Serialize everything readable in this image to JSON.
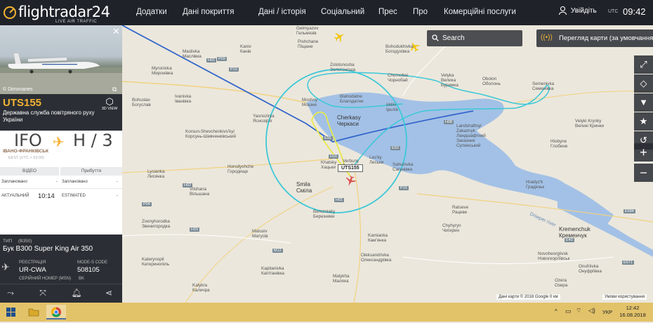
{
  "topbar": {
    "brand": "flightradar24",
    "tagline": "LIVE AIR TRAFFIC",
    "nav": [
      "Додатки",
      "Дані покриття",
      "Дані / історія",
      "Соціальний",
      "Прес",
      "Про",
      "Комерційні послуги"
    ],
    "login": "Увійдіть",
    "utc_label": "UTC",
    "clock": "09:42"
  },
  "map": {
    "search_placeholder": "Search",
    "view_label": "Перегляд карти (за умовчанням)",
    "flight_label": "UTS155",
    "attribution": "Дані карти © 2018 Google   0 км",
    "terms": "Умови користування",
    "places_small": [
      {
        "t": "Gelmyazov\nГельмязів"
      },
      {
        "t": "Pishchane\nПіщане"
      },
      {
        "t": "Bohodukhivka\nБогодухівка"
      },
      {
        "t": "Zolotonosha\nЗолотоноша"
      },
      {
        "t": "Chornobai\nЧорнобай"
      },
      {
        "t": "Myronivka\nМиронівка"
      },
      {
        "t": "Maslivka\nМаслівка"
      },
      {
        "t": "Kaniv\nКанів"
      },
      {
        "t": "Bohuslav\nБогуслав"
      },
      {
        "t": "Ivanivka\nІванівка"
      },
      {
        "t": "Moshny\nМошни"
      },
      {
        "t": "Blahodatne\nБлагодатне"
      },
      {
        "t": "Velyka\nВелика\nБуримка"
      },
      {
        "t": "Irkliiv\nІрклїв"
      },
      {
        "t": "Obolon\nОболонь"
      },
      {
        "t": "Semenivka\nСеменівка"
      },
      {
        "t": "Yasnozirya\nЯснозір'я"
      },
      {
        "t": "Korsun-Shevchenkivs'kyi\nКорсунь-Шевченківський"
      },
      {
        "t": "Landshaftnyi\nZakaznyk\nЛандшафтний\nЗаказник\nСулинський"
      },
      {
        "t": "Velyki Krynky\nВеликі Кринки"
      },
      {
        "t": "Hlobyne\nГлобине"
      },
      {
        "t": "Lysianka\nЛисянка"
      },
      {
        "t": "Horodyshche\nГородище"
      },
      {
        "t": "Khatsky\nХацьки"
      },
      {
        "t": "Verbuny\nВербуни"
      },
      {
        "t": "Les'ky\nЛеськи"
      },
      {
        "t": "Sahunivka\nСагунівка"
      },
      {
        "t": "Zvenyhorodka\nЗвенигородка"
      },
      {
        "t": "Vilshana\nВільшана"
      },
      {
        "t": "Berezniaky\nБерезняки"
      },
      {
        "t": "Chyhyryn\nЧигирин"
      },
      {
        "t": "Hradyz'k\nГрадизьк"
      },
      {
        "t": "Ratseve\nРацеве"
      },
      {
        "t": "Kamianka\nКам'янка"
      },
      {
        "t": "Matusiv\nМатусів"
      },
      {
        "t": "Katerynopil\nКатеринопіль"
      },
      {
        "t": "Oleksandrivka\nОлександрівка"
      },
      {
        "t": "Novoheorgiivsk\nНовогеоргіївськ"
      },
      {
        "t": "Kapitanivka\nКапітанівка"
      },
      {
        "t": "Malykha\nМаляха"
      },
      {
        "t": "Onufriivka\nОнуфріївка"
      },
      {
        "t": "Ozera\nОзера"
      },
      {
        "t": "Kalykra\nКаличра"
      }
    ],
    "places_big": [
      {
        "t": "Cherkasy\nЧеркаси"
      },
      {
        "t": "Smila\nСміла"
      },
      {
        "t": "Kremenchuk\nКременчук"
      }
    ],
    "river_label": "Dnieper river",
    "roads": [
      "H01",
      "P09",
      "P10",
      "H16",
      "H08",
      "E50",
      "P04",
      "H15",
      "E95",
      "E584",
      "H02",
      "M12",
      "P15",
      "E571",
      "E40",
      "H01"
    ]
  },
  "sidebar": {
    "photo_credit": "© Dimonanes",
    "callsign": "UTS155",
    "airline": "Державна служба повітряного руху України",
    "view3d": "3D VIEW",
    "origin_iata": "IFO",
    "dest_iata": "H / 3",
    "origin_city": "ІВАНО-ФРАНКІВСЬК",
    "origin_tz": "EEST (UTC + 03:00)",
    "col_departure": "ВІДЕО",
    "col_arrival": "Прибуття",
    "scheduled": "Заплановано",
    "scheduled_val_dep": "-",
    "scheduled_arr": "Заплановано",
    "scheduled_val_arr": "-",
    "actual": "АКТУАЛЬНИЙ",
    "actual_val": "10:14",
    "estimated": "ESTIMATED",
    "estimated_val": "-",
    "type_label": "ТИП",
    "type_code": "(B350)",
    "type_name": "Бук B300 Super King Air 350",
    "reg_label": "РЕЄСТРАЦІЯ",
    "reg_val": "UR-CWA",
    "modes_label": "MODE-S CODE",
    "modes_val": "508105",
    "serial_label": "СЕРІЙНИЙ НОМЕР (MSN)",
    "serial_val": "BK"
  },
  "taskbar": {
    "lang": "УКР",
    "time": "12:42",
    "date": "16.08.2018"
  },
  "colors": {
    "accent": "#f3b233",
    "track_blue": "#3366cc",
    "track_cyan": "#3cc8d8",
    "track_yellow": "#e8e84a",
    "water": "#a3c1e6"
  }
}
